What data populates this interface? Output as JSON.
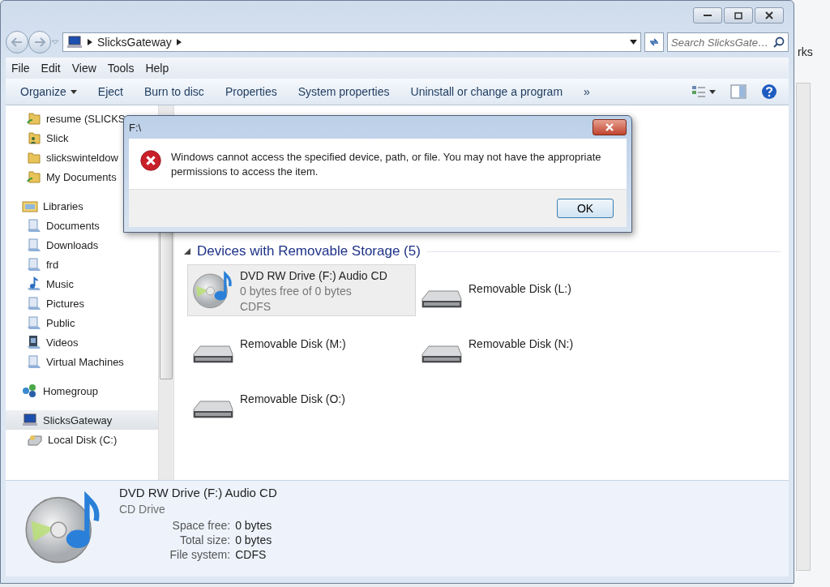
{
  "window": {
    "address": {
      "path": [
        "SlicksGateway"
      ]
    },
    "search": {
      "placeholder": "Search SlicksGate…"
    }
  },
  "menu": [
    "File",
    "Edit",
    "View",
    "Tools",
    "Help"
  ],
  "toolbar": [
    {
      "label": "Organize",
      "kind": "dropdown"
    },
    {
      "label": "Eject",
      "kind": "plain"
    },
    {
      "label": "Burn to disc",
      "kind": "plain"
    },
    {
      "label": "Properties",
      "kind": "plain"
    },
    {
      "label": "System properties",
      "kind": "plain"
    },
    {
      "label": "Uninstall or change a program",
      "kind": "plain"
    },
    {
      "label": "»",
      "kind": "more"
    }
  ],
  "nav": [
    {
      "label": "resume (SLICKS",
      "kind": "share",
      "selected": false
    },
    {
      "label": "Slick",
      "kind": "user",
      "selected": false
    },
    {
      "label": "slickswinteldow",
      "kind": "folder",
      "selected": false
    },
    {
      "label": "My Documents",
      "kind": "share",
      "selected": false
    },
    {
      "label": "Libraries",
      "kind": "libraries",
      "selected": false,
      "children": [
        {
          "label": "Documents",
          "kind": "library",
          "selected": false
        },
        {
          "label": "Downloads",
          "kind": "library",
          "selected": false
        },
        {
          "label": "frd",
          "kind": "library",
          "selected": false
        },
        {
          "label": "Music",
          "kind": "music",
          "selected": false
        },
        {
          "label": "Pictures",
          "kind": "library",
          "selected": false
        },
        {
          "label": "Public",
          "kind": "library",
          "selected": false
        },
        {
          "label": "Videos",
          "kind": "video",
          "selected": false
        },
        {
          "label": "Virtual Machines",
          "kind": "library",
          "selected": false
        }
      ]
    },
    {
      "label": "Homegroup",
      "kind": "homegroup",
      "selected": false
    },
    {
      "label": "SlicksGateway",
      "kind": "computer",
      "selected": true,
      "children": [
        {
          "label": "Local Disk (C:)",
          "kind": "disk",
          "selected": false
        }
      ]
    }
  ],
  "section": {
    "title": "Devices with Removable Storage (5)",
    "expanded": true
  },
  "devices": [
    {
      "name": "DVD RW Drive (F:) Audio CD",
      "kind": "cd",
      "selected": true,
      "lines": [
        "0 bytes free of 0 bytes",
        "CDFS"
      ]
    },
    {
      "name": "Removable Disk (L:)",
      "kind": "removable",
      "selected": false
    },
    {
      "name": "Removable Disk (M:)",
      "kind": "removable",
      "selected": false
    },
    {
      "name": "Removable Disk (N:)",
      "kind": "removable",
      "selected": false
    },
    {
      "name": "Removable Disk (O:)",
      "kind": "removable",
      "selected": false
    }
  ],
  "details": {
    "title": "DVD RW Drive (F:) Audio CD",
    "type": "CD Drive",
    "kind": "cd",
    "properties": [
      {
        "label": "Space free:",
        "value": "0 bytes"
      },
      {
        "label": "Total size:",
        "value": "0 bytes"
      },
      {
        "label": "File system:",
        "value": "CDFS"
      }
    ]
  },
  "dialog": {
    "title": "F:\\",
    "message": "Windows cannot access the specified device, path, or file.  You may not have the appropriate permissions to access the item.",
    "buttons": [
      "OK"
    ]
  },
  "background": {
    "text": "rks"
  }
}
